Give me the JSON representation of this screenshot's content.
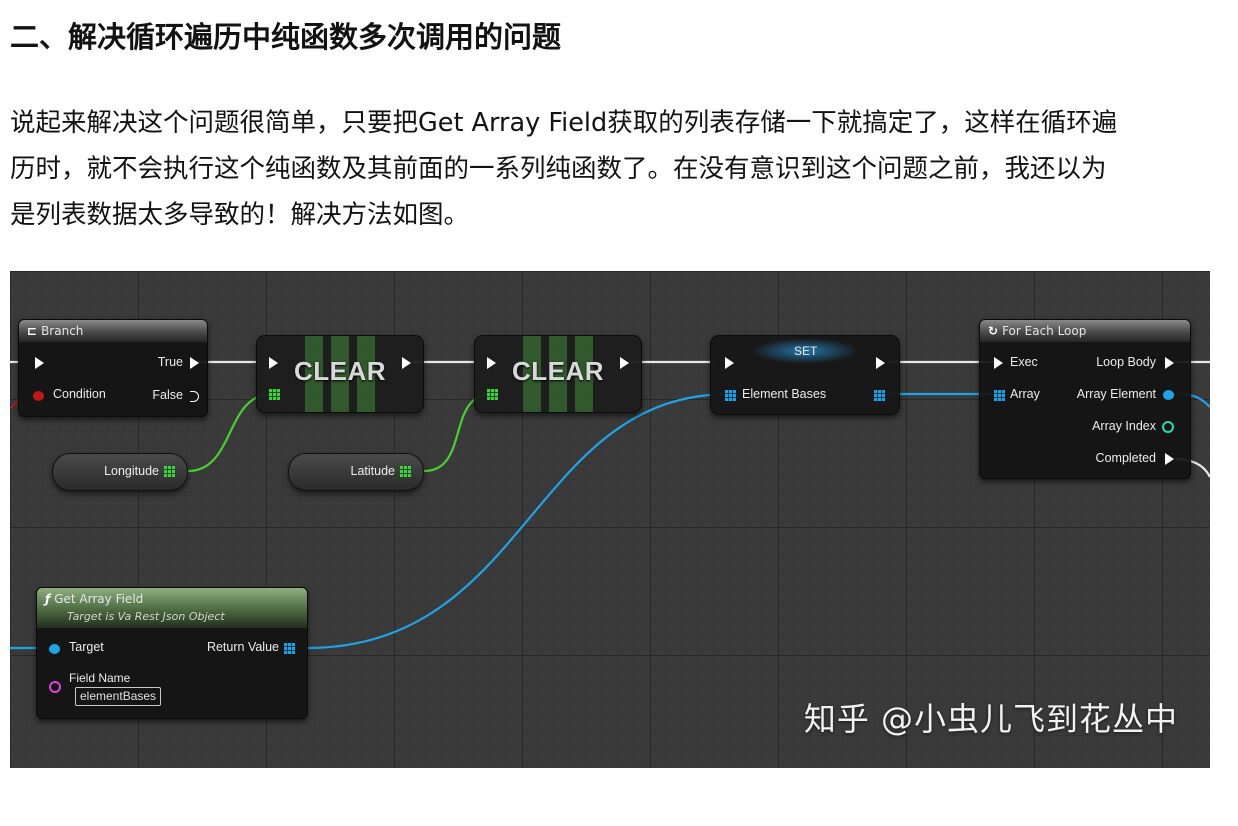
{
  "article": {
    "heading": "二、解决循环遍历中纯函数多次调用的问题",
    "paragraph_lines": [
      "说起来解决这个问题很简单，只要把Get Array Field获取的列表存储一下就搞定了，这样在循环遍",
      "历时，就不会执行这个纯函数及其前面的一系列纯函数了。在没有意识到这个问题之前，我还以为",
      "是列表数据太多导致的！解决方法如图。"
    ]
  },
  "blueprint": {
    "branch": {
      "title": "Branch",
      "true": "True",
      "condition": "Condition",
      "false": "False"
    },
    "clear1": {
      "label": "CLEAR"
    },
    "clear2": {
      "label": "CLEAR"
    },
    "longitude": {
      "label": "Longitude"
    },
    "latitude": {
      "label": "Latitude"
    },
    "set": {
      "title": "SET",
      "element": "Element Bases"
    },
    "foreach": {
      "title": "For Each Loop",
      "exec": "Exec",
      "loop_body": "Loop Body",
      "array": "Array",
      "array_element": "Array Element",
      "array_index": "Array Index",
      "completed": "Completed"
    },
    "getfield": {
      "title": "Get Array Field",
      "subtitle": "Target is Va Rest Json Object",
      "target": "Target",
      "return_value": "Return Value",
      "field_name": "Field Name",
      "field_value": "elementBases"
    },
    "watermark": "知乎 @小虫儿飞到花丛中",
    "colors": {
      "exec": "#ffffff",
      "array": "#1ea3e6",
      "float": "#3ed33e",
      "bool": "#c01818",
      "string": "#e040e0",
      "int": "#2ed8a8"
    }
  }
}
